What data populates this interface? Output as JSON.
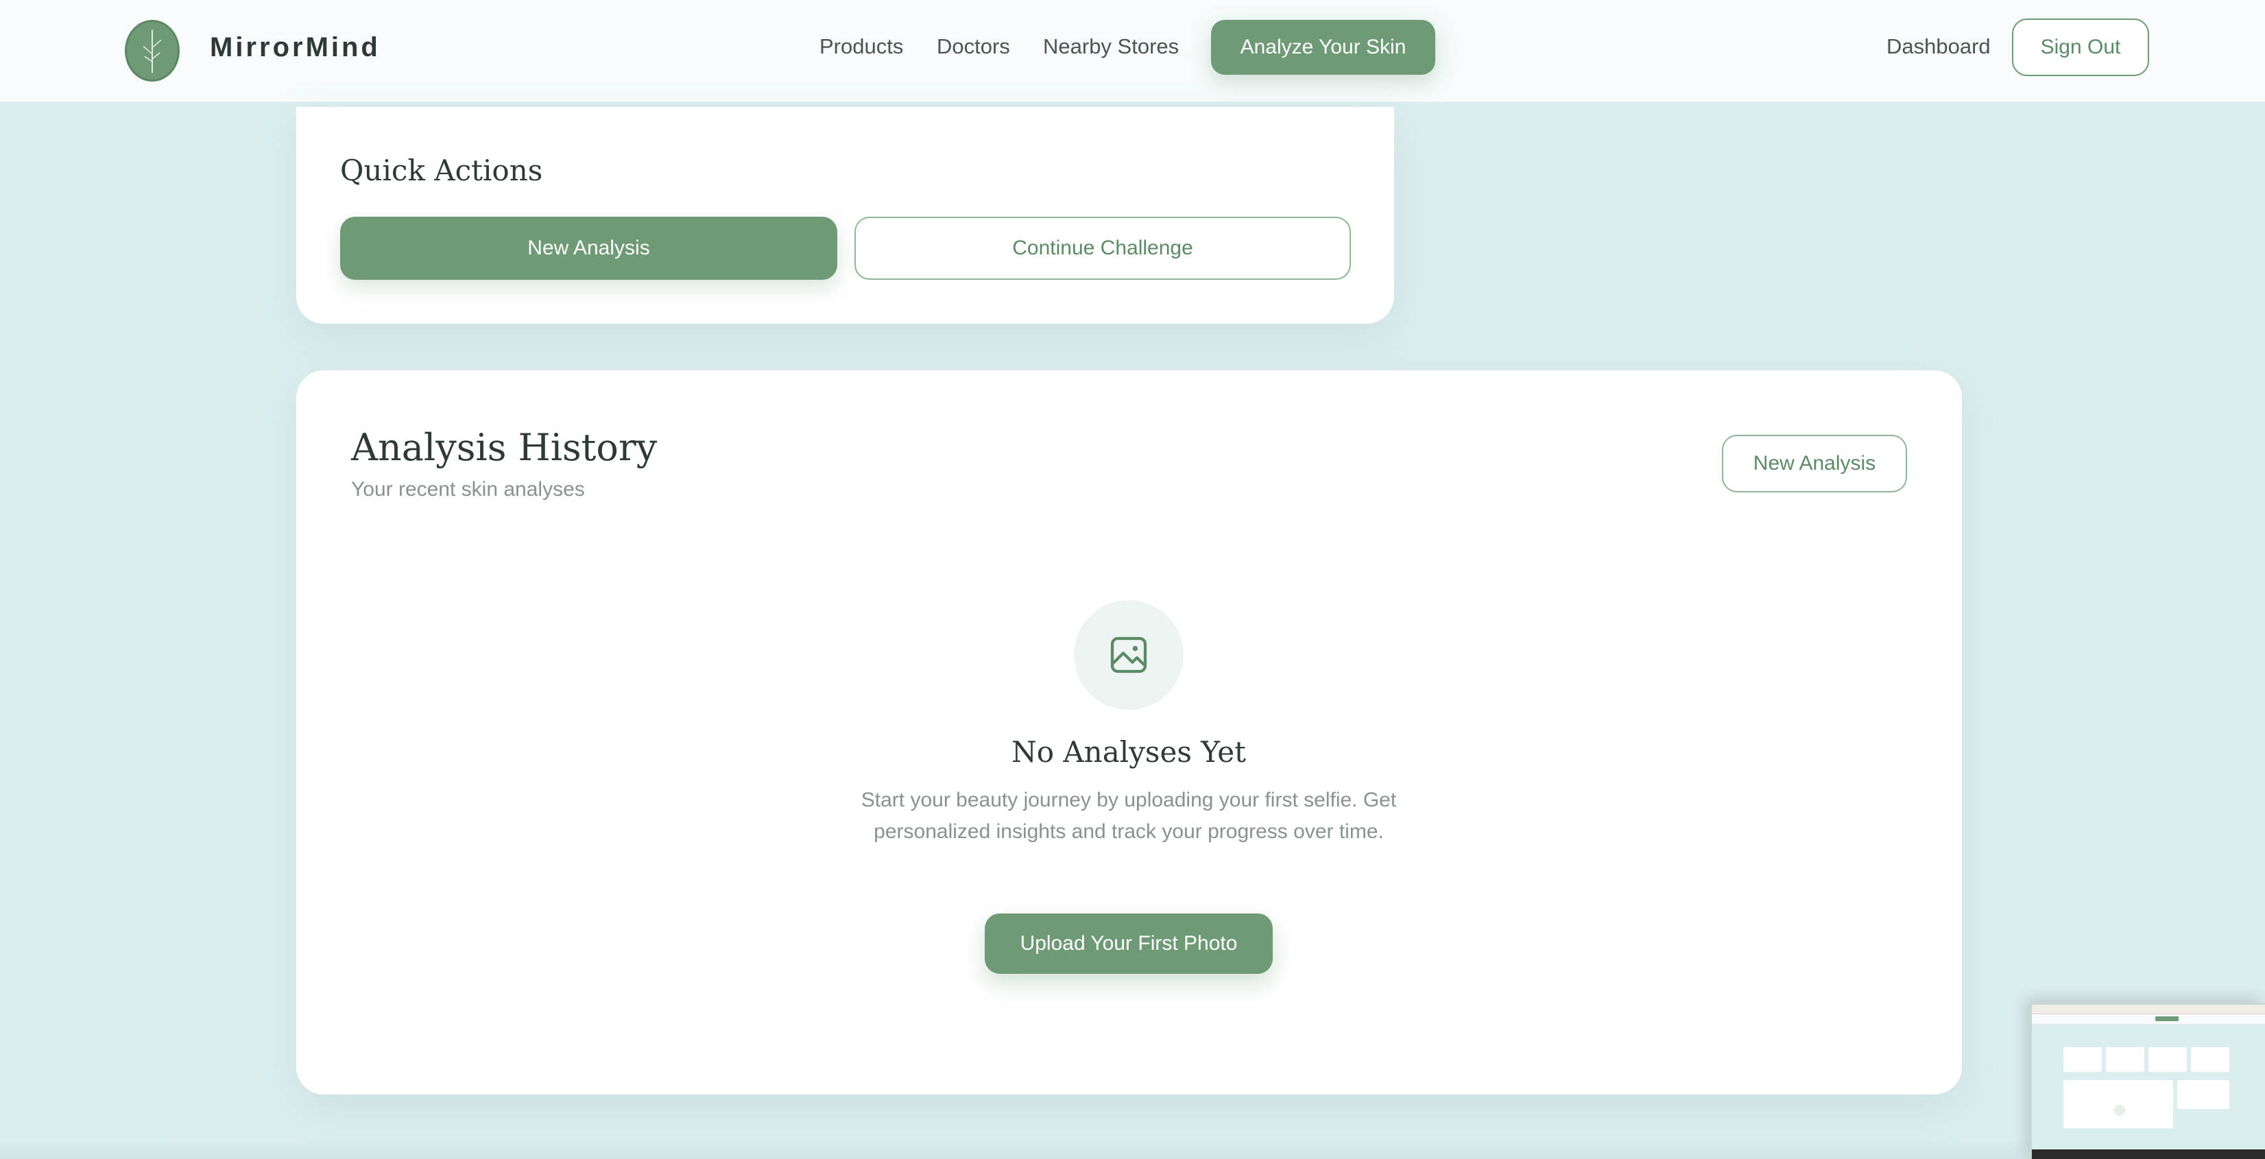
{
  "header": {
    "brand": "MirrorMind",
    "nav": {
      "products": "Products",
      "doctors": "Doctors",
      "nearby_stores": "Nearby Stores",
      "analyze": "Analyze Your Skin",
      "dashboard": "Dashboard",
      "sign_out": "Sign Out"
    },
    "logo_icon": "leaf-logo-icon"
  },
  "quick_actions": {
    "title": "Quick Actions",
    "new_analysis": "New Analysis",
    "continue_challenge": "Continue Challenge"
  },
  "history": {
    "title": "Analysis History",
    "subtitle": "Your recent skin analyses",
    "new_analysis": "New Analysis",
    "empty": {
      "icon": "image-icon",
      "title": "No Analyses Yet",
      "description": "Start your beauty journey by uploading your first selfie. Get personalized insights and track your progress over time.",
      "button": "Upload Your First Photo"
    }
  },
  "colors": {
    "accent": "#6e9b76",
    "background": "#dcedee",
    "card": "#ffffff",
    "text": "#2f3a36",
    "muted": "#8a928f"
  }
}
